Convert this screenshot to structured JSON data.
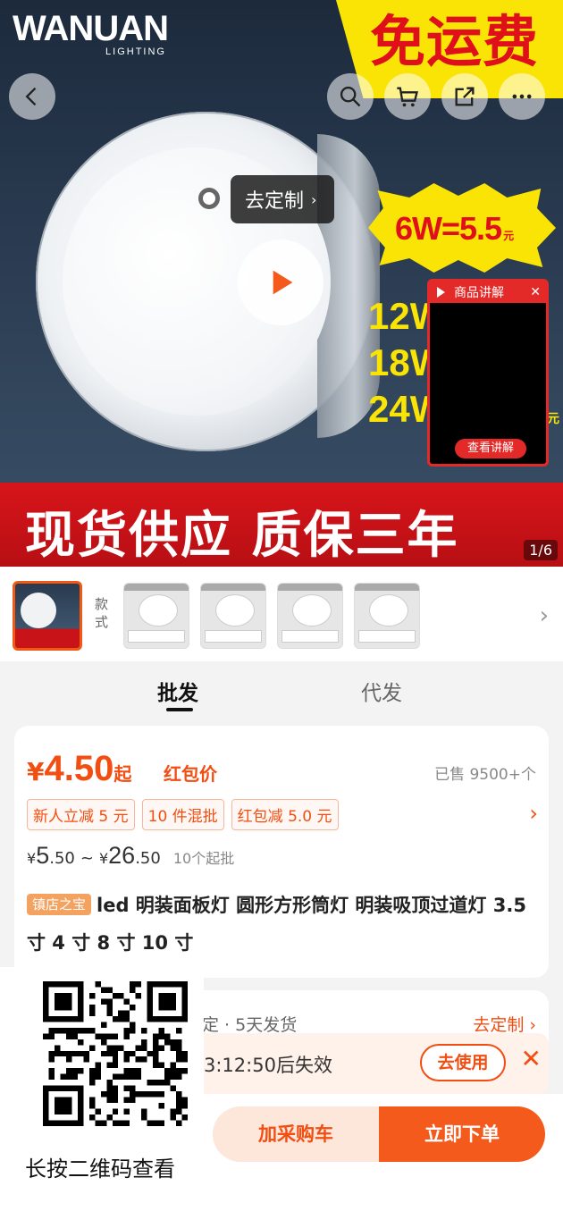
{
  "hero": {
    "brand_name": "WANUAN",
    "brand_sub": "LIGHTING",
    "free_shipping": "免运费",
    "customize_tag": "去定制",
    "price_burst_main": "6W=5.5",
    "price_burst_unit": "元",
    "watts": [
      "12W",
      "18W",
      "24W"
    ],
    "watts_unit": "元",
    "explain_title": "商品讲解",
    "explain_button": "查看讲解",
    "banner_text": "现货供应  质保三年",
    "image_counter": "1/6",
    "icons": [
      "back-icon",
      "search-icon",
      "cart-icon",
      "share-icon",
      "more-icon",
      "play-icon",
      "close-icon"
    ]
  },
  "thumbs": {
    "style_label": "款式",
    "count": 4
  },
  "tabs": [
    {
      "label": "批发",
      "active": true
    },
    {
      "label": "代发",
      "active": false
    }
  ],
  "price_card": {
    "currency": "¥",
    "price": "4.50",
    "price_suffix": "起",
    "red_packet_label": "红包价",
    "sold": "已售 9500+个",
    "promos": [
      "新人立减 5 元",
      "10 件混批",
      "红包减 5.0 元"
    ],
    "range_low_int": "5",
    "range_low_dec": ".50",
    "range_sep": "~",
    "range_high_int": "26",
    "range_high_dec": ".50",
    "min_order": "10个起批",
    "treasure_badge": "镇店之宝",
    "title": "led 明装面板灯 圆形方形筒灯 明装吸顶过道灯 3.5 寸 4 寸 8 寸 10 寸"
  },
  "shipping": {
    "text": "定 · 5天发货",
    "link": "去定制"
  },
  "coupon": {
    "timer_text": "3:12:50后失效",
    "use_button": "去使用"
  },
  "bottom_bar": {
    "cart_button": "加采购车",
    "buy_button": "立即下单"
  },
  "qr": {
    "caption": "长按二维码查看"
  },
  "colors": {
    "accent": "#f24e12",
    "banner_red": "#c81319",
    "yellow": "#f9e405"
  }
}
